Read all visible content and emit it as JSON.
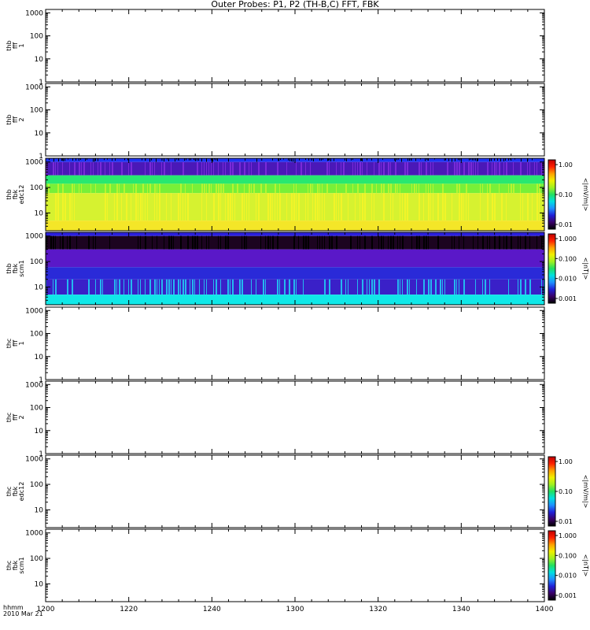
{
  "title": "Outer Probes: P1, P2 (TH-B,C) FFT, FBK",
  "x_axis": {
    "tick_labels": [
      "1200",
      "1220",
      "1240",
      "1300",
      "1320",
      "1340",
      "1400"
    ],
    "label_line1": "hhmm",
    "label_line2": "2010 Mar 21"
  },
  "chart_data": [
    {
      "type": "heatmap",
      "panel_label": [
        "thb",
        "fff",
        "1"
      ],
      "yticks": [
        "1000",
        "100",
        "10",
        "1"
      ],
      "ylog": true,
      "ylim": [
        1,
        1400
      ],
      "has_data": false
    },
    {
      "type": "heatmap",
      "panel_label": [
        "thb",
        "fff",
        "2"
      ],
      "yticks": [
        "1000",
        "100",
        "10",
        "1"
      ],
      "ylog": true,
      "ylim": [
        1,
        1400
      ],
      "has_data": false
    },
    {
      "type": "heatmap",
      "panel_label": [
        "thb",
        "fbk",
        "edc12"
      ],
      "yticks": [
        "1000",
        "100",
        "10"
      ],
      "ylog": true,
      "ylim": [
        2,
        1400
      ],
      "has_data": true,
      "colorbar": {
        "ticks": [
          "1.00",
          "0.10",
          "0.01"
        ],
        "unit": "<|mV/m|>",
        "log": true
      },
      "bands": [
        {
          "freq_hz": [
            1000,
            1400
          ],
          "color": "#1e34f5",
          "dark_spikes": true
        },
        {
          "freq_hz": [
            300,
            1000
          ],
          "color": "#4a18b8",
          "stripes": "#7a2ad8"
        },
        {
          "freq_hz": [
            140,
            300
          ],
          "color": "#28e870"
        },
        {
          "freq_hz": [
            60,
            140
          ],
          "color": "#78f038",
          "stripes": "#b8f430"
        },
        {
          "freq_hz": [
            5,
            60
          ],
          "color": "#d6f230",
          "stripes": "#f2f428"
        },
        {
          "freq_hz": [
            2,
            5
          ],
          "color": "#f4e628"
        }
      ]
    },
    {
      "type": "heatmap",
      "panel_label": [
        "thb",
        "fbk",
        "scm1"
      ],
      "yticks": [
        "1000",
        "100",
        "10"
      ],
      "ylog": true,
      "ylim": [
        2,
        1400
      ],
      "has_data": true,
      "colorbar": {
        "ticks": [
          "1.000",
          "0.100",
          "0.010",
          "0.001"
        ],
        "unit": "<|nT|>",
        "log": true
      },
      "bands": [
        {
          "freq_hz": [
            1000,
            1400
          ],
          "color": "#2b20e0"
        },
        {
          "freq_hz": [
            300,
            1000
          ],
          "color": "#1c0420",
          "stripes": "#000000"
        },
        {
          "freq_hz": [
            60,
            300
          ],
          "color": "#5a18c8"
        },
        {
          "freq_hz": [
            20,
            60
          ],
          "color": "#2a2ad8"
        },
        {
          "freq_hz": [
            5,
            20
          ],
          "color": "#3a20c8",
          "stripes": "#24b8f0"
        },
        {
          "freq_hz": [
            2,
            5
          ],
          "color": "#10e8e8"
        }
      ]
    },
    {
      "type": "heatmap",
      "panel_label": [
        "thc",
        "fff",
        "1"
      ],
      "yticks": [
        "1000",
        "100",
        "10",
        "1"
      ],
      "ylog": true,
      "ylim": [
        1,
        1400
      ],
      "has_data": false
    },
    {
      "type": "heatmap",
      "panel_label": [
        "thc",
        "fff",
        "2"
      ],
      "yticks": [
        "1000",
        "100",
        "10",
        "1"
      ],
      "ylog": true,
      "ylim": [
        1,
        1400
      ],
      "has_data": false
    },
    {
      "type": "heatmap",
      "panel_label": [
        "thc",
        "fbk",
        "edc12"
      ],
      "yticks": [
        "1000",
        "100",
        "10"
      ],
      "ylog": true,
      "ylim": [
        2,
        1400
      ],
      "has_data": false,
      "colorbar": {
        "ticks": [
          "1.00",
          "0.10",
          "0.01"
        ],
        "unit": "<|mV/m|>",
        "log": true
      }
    },
    {
      "type": "heatmap",
      "panel_label": [
        "thc",
        "fbk",
        "scm1"
      ],
      "yticks": [
        "1000",
        "100",
        "10"
      ],
      "ylog": true,
      "ylim": [
        2,
        1400
      ],
      "has_data": false,
      "colorbar": {
        "ticks": [
          "1.000",
          "0.100",
          "0.010",
          "0.001"
        ],
        "unit": "<|nT|>",
        "log": true
      }
    }
  ],
  "colors": {
    "axis": "#000000",
    "background": "#ffffff"
  }
}
